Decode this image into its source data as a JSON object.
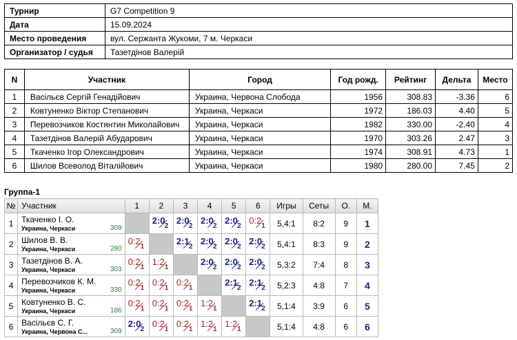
{
  "info": [
    {
      "label": "Турнир",
      "value": "G7 Competition 9"
    },
    {
      "label": "Дата",
      "value": "15.09.2024"
    },
    {
      "label": "Место проведения",
      "value": "вул. Сержанта Жукоми, 7 м. Черкаси"
    },
    {
      "label": "Организатор / судья",
      "value": "Тазетдінов Валерій"
    }
  ],
  "participants": {
    "headers": [
      "N",
      "Участник",
      "Город",
      "Год рожд.",
      "Рейтинг",
      "Дельта",
      "Место"
    ],
    "rows": [
      [
        "1",
        "Васільєв Сергій Генадійович",
        "Украина, Червона Слобода",
        "1956",
        "308.83",
        "-3.36",
        "6"
      ],
      [
        "2",
        "Ковтуненко Віктор Степанович",
        "Украина, Черкаси",
        "1972",
        "186.03",
        "4.40",
        "5"
      ],
      [
        "3",
        "Перевозчиков Костянтин Миколайович",
        "Украина, Черкаси",
        "1982",
        "330.00",
        "-2.40",
        "4"
      ],
      [
        "4",
        "Тазетдінов Валерій Абударович",
        "Украина, Черкаси",
        "1970",
        "303.26",
        "2.47",
        "3"
      ],
      [
        "5",
        "Ткаченко Ігор Олександрович",
        "Украина, Черкаси",
        "1974",
        "308.91",
        "4.73",
        "1"
      ],
      [
        "6",
        "Шилов Всеволод Віталійович",
        "Украина, Черкаси",
        "1980",
        "280.00",
        "7.45",
        "2"
      ]
    ]
  },
  "group": {
    "title": "Группа-1",
    "headers": [
      "№",
      "Участник",
      "1",
      "2",
      "3",
      "4",
      "5",
      "6",
      "Игры",
      "Сеты",
      "О.",
      "М."
    ],
    "rows": [
      {
        "num": "1",
        "name": "Ткаченко І. О.",
        "city": "Украина, Черкаси",
        "rating": "309",
        "cells": [
          null,
          {
            "s": "2:0",
            "p": "2",
            "r": "win"
          },
          {
            "s": "2:0",
            "p": "2",
            "r": "win"
          },
          {
            "s": "2:0",
            "p": "2",
            "r": "win"
          },
          {
            "s": "2:0",
            "p": "2",
            "r": "win"
          },
          {
            "s": "0:2",
            "p": "1",
            "r": "loss"
          }
        ],
        "games": "5,4:1",
        "sets": "8:2",
        "points": "9",
        "place": "1"
      },
      {
        "num": "2",
        "name": "Шилов В. В.",
        "city": "Украина, Черкаси",
        "rating": "280",
        "cells": [
          {
            "s": "0:2",
            "p": "1",
            "r": "loss"
          },
          null,
          {
            "s": "2:1",
            "p": "2",
            "r": "win"
          },
          {
            "s": "2:0",
            "p": "2",
            "r": "win"
          },
          {
            "s": "2:0",
            "p": "2",
            "r": "win"
          },
          {
            "s": "2:0",
            "p": "2",
            "r": "win"
          }
        ],
        "games": "5,4:1",
        "sets": "8:3",
        "points": "9",
        "place": "2"
      },
      {
        "num": "3",
        "name": "Тазетдінов В. А.",
        "city": "Украина, Черкаси",
        "rating": "303",
        "cells": [
          {
            "s": "0:2",
            "p": "1",
            "r": "loss"
          },
          {
            "s": "1:2",
            "p": "1",
            "r": "draw"
          },
          null,
          {
            "s": "2:0",
            "p": "2",
            "r": "win"
          },
          {
            "s": "2:0",
            "p": "2",
            "r": "win"
          },
          {
            "s": "2:0",
            "p": "2",
            "r": "win"
          }
        ],
        "games": "5,3:2",
        "sets": "7:4",
        "points": "8",
        "place": "3"
      },
      {
        "num": "4",
        "name": "Перевозчиков К. М.",
        "city": "Украина, Черкаси",
        "rating": "330",
        "cells": [
          {
            "s": "0:2",
            "p": "1",
            "r": "loss"
          },
          {
            "s": "0:2",
            "p": "1",
            "r": "loss"
          },
          {
            "s": "0:2",
            "p": "1",
            "r": "loss"
          },
          null,
          {
            "s": "2:1",
            "p": "2",
            "r": "win"
          },
          {
            "s": "2:1",
            "p": "2",
            "r": "win"
          }
        ],
        "games": "5,2:3",
        "sets": "4:8",
        "points": "7",
        "place": "4"
      },
      {
        "num": "5",
        "name": "Ковтуненко В. С.",
        "city": "Украина, Черкаси",
        "rating": "186",
        "cells": [
          {
            "s": "0:2",
            "p": "1",
            "r": "loss"
          },
          {
            "s": "0:2",
            "p": "1",
            "r": "loss"
          },
          {
            "s": "0:2",
            "p": "1",
            "r": "loss"
          },
          {
            "s": "1:2",
            "p": "1",
            "r": "draw"
          },
          null,
          {
            "s": "2:1",
            "p": "2",
            "r": "win"
          }
        ],
        "games": "5,1:4",
        "sets": "3:9",
        "points": "6",
        "place": "5"
      },
      {
        "num": "6",
        "name": "Васільєв С. Г.",
        "city": "Украина, Червона С...",
        "rating": "309",
        "cells": [
          {
            "s": "2:0",
            "p": "2",
            "r": "win"
          },
          {
            "s": "0:2",
            "p": "1",
            "r": "loss"
          },
          {
            "s": "0:2",
            "p": "1",
            "r": "loss"
          },
          {
            "s": "1:2",
            "p": "1",
            "r": "draw"
          },
          {
            "s": "1:2",
            "p": "1",
            "r": "draw"
          },
          null
        ],
        "games": "5,1:4",
        "sets": "4:8",
        "points": "6",
        "place": "6"
      }
    ]
  },
  "colors": {
    "win": "#1a237e",
    "loss": "#9a2a2a",
    "rating": "#2e7d32",
    "self_cell": "#c8c8c8"
  }
}
